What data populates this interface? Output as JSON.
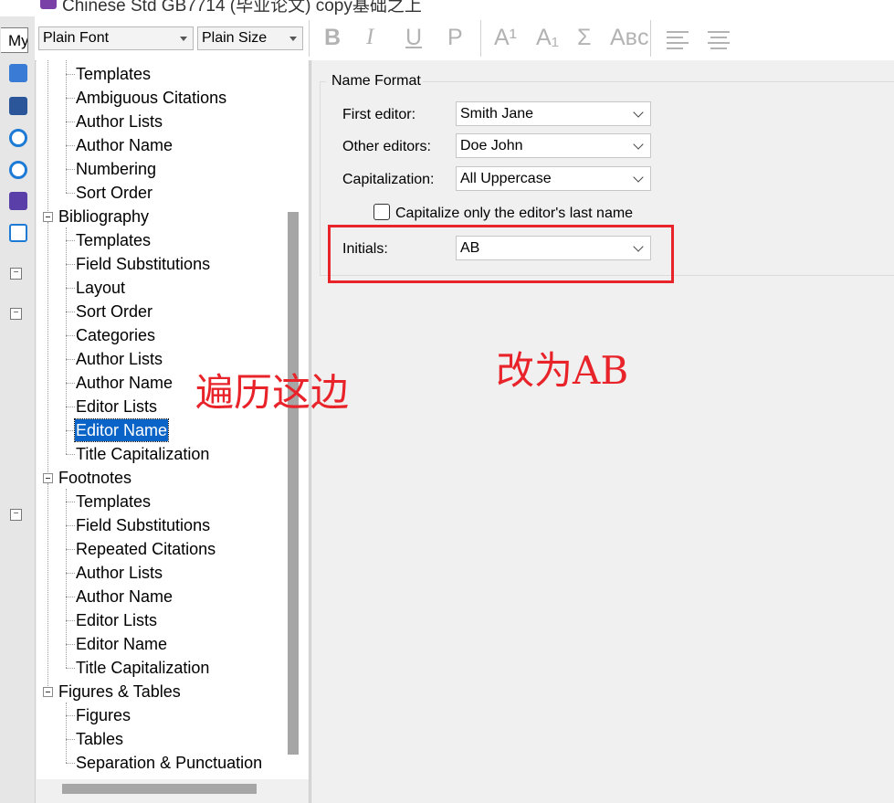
{
  "window": {
    "title": "Chinese Std GB7714 (毕业论文) copy基础之上",
    "style_box": "My"
  },
  "toolbar": {
    "font": "Plain Font",
    "size": "Plain Size",
    "buttons": [
      "B",
      "I",
      "U",
      "P",
      "A¹",
      "A₁",
      "Σ",
      "Aʙᴄ"
    ]
  },
  "tree": {
    "citations_children": [
      "Templates",
      "Ambiguous Citations",
      "Author Lists",
      "Author Name",
      "Numbering",
      "Sort Order"
    ],
    "bibliography": {
      "label": "Bibliography",
      "children": [
        "Templates",
        "Field Substitutions",
        "Layout",
        "Sort Order",
        "Categories",
        "Author Lists",
        "Author Name",
        "Editor Lists",
        "Editor Name",
        "Title Capitalization"
      ]
    },
    "footnotes": {
      "label": "Footnotes",
      "children": [
        "Templates",
        "Field Substitutions",
        "Repeated Citations",
        "Author Lists",
        "Author Name",
        "Editor Lists",
        "Editor Name",
        "Title Capitalization"
      ]
    },
    "figures": {
      "label": "Figures & Tables",
      "children": [
        "Figures",
        "Tables",
        "Separation & Punctuation"
      ]
    },
    "selected": "Editor Name"
  },
  "name_format": {
    "group_title": "Name Format",
    "first_editor_label": "First editor:",
    "first_editor_value": "Smith Jane",
    "other_editors_label": "Other editors:",
    "other_editors_value": "Doe John",
    "capitalization_label": "Capitalization:",
    "capitalization_value": "All Uppercase",
    "checkbox_label": "Capitalize only the editor's last name",
    "checkbox_checked": false,
    "initials_label": "Initials:",
    "initials_value": "AB"
  },
  "annotations": {
    "left_note": "遍历这边",
    "right_note": "改为AB",
    "color": "#e8232a"
  }
}
